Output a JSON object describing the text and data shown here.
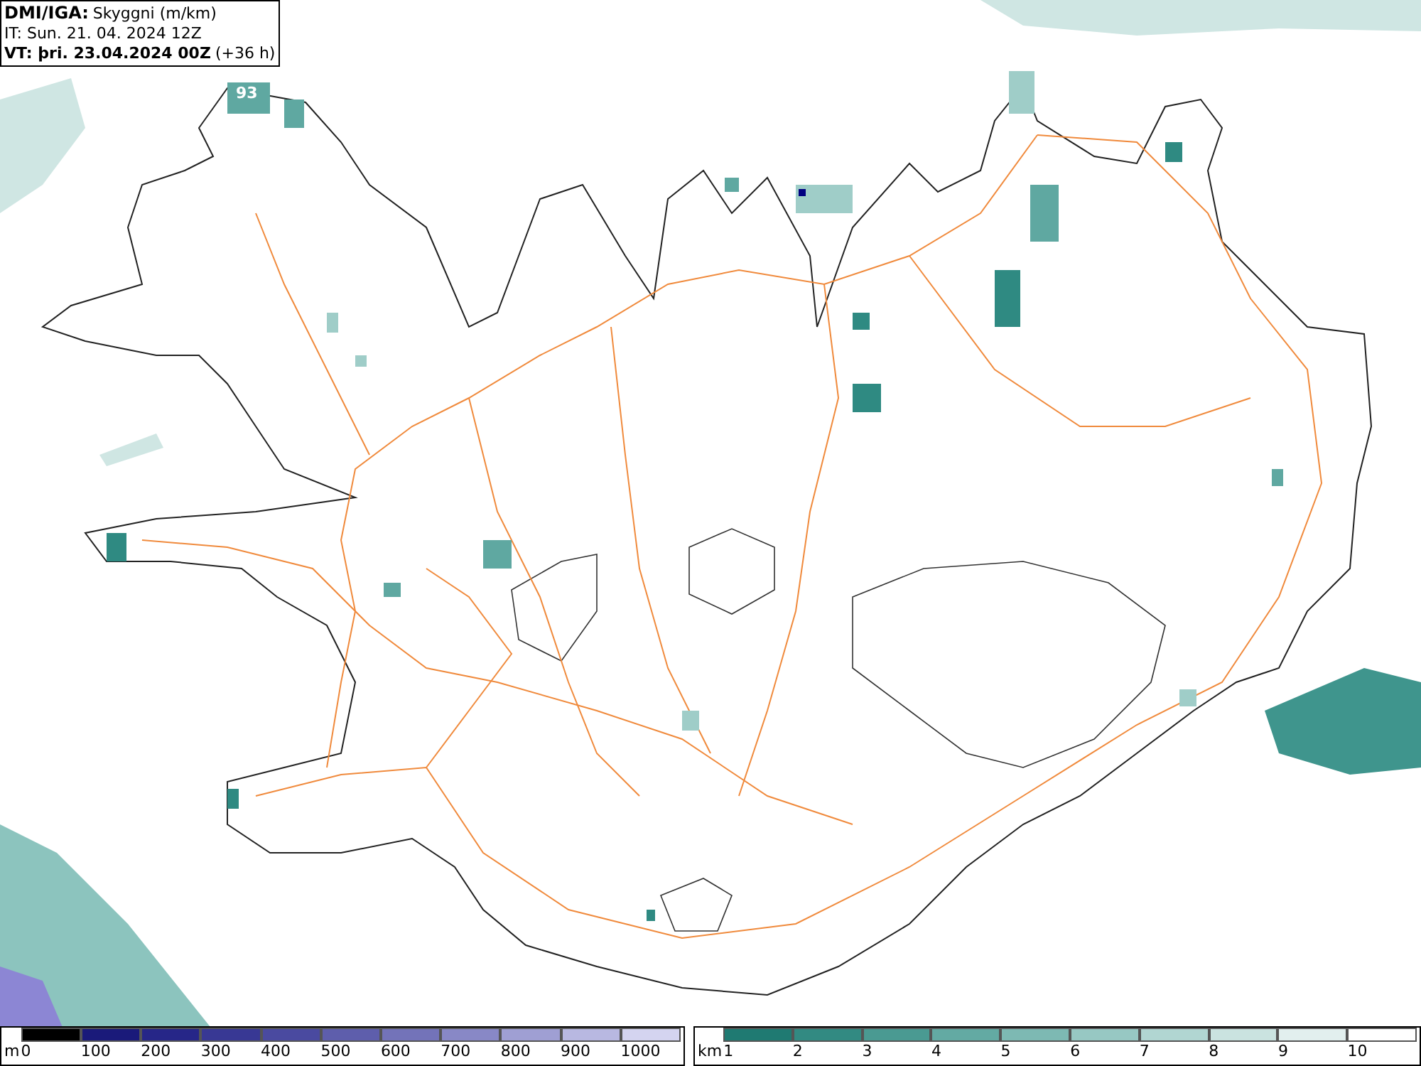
{
  "header": {
    "source": "DMI/IGA:",
    "parameter": "Skyggni (m/km)",
    "issue_time": "IT: Sun. 21. 04. 2024 12Z",
    "valid_label": "VT: þri. 23.04.2024 00Z",
    "valid_offset": "(+36 h)"
  },
  "map": {
    "labels": [
      "93"
    ]
  },
  "legends": [
    {
      "unit": "m",
      "items": [
        {
          "label": "0",
          "color": "#000000"
        },
        {
          "label": "100",
          "color": "#1a1a7a"
        },
        {
          "label": "200",
          "color": "#262688"
        },
        {
          "label": "300",
          "color": "#383894"
        },
        {
          "label": "400",
          "color": "#4a4aa0"
        },
        {
          "label": "500",
          "color": "#5e5eac"
        },
        {
          "label": "600",
          "color": "#7373b9"
        },
        {
          "label": "700",
          "color": "#8888c6"
        },
        {
          "label": "800",
          "color": "#9f9fd3"
        },
        {
          "label": "900",
          "color": "#b8b8e1"
        },
        {
          "label": "1000",
          "color": "#d4d4f0"
        }
      ]
    },
    {
      "unit": "km",
      "items": [
        {
          "label": "1",
          "color": "#1f7a72"
        },
        {
          "label": "2",
          "color": "#328a82"
        },
        {
          "label": "3",
          "color": "#4a9a92"
        },
        {
          "label": "4",
          "color": "#63aaa3"
        },
        {
          "label": "5",
          "color": "#7db9b3"
        },
        {
          "label": "6",
          "color": "#97c8c3"
        },
        {
          "label": "7",
          "color": "#b1d6d2"
        },
        {
          "label": "8",
          "color": "#cae3e0"
        },
        {
          "label": "9",
          "color": "#e2efee"
        },
        {
          "label": "10",
          "color": "#ffffff"
        }
      ]
    }
  ]
}
